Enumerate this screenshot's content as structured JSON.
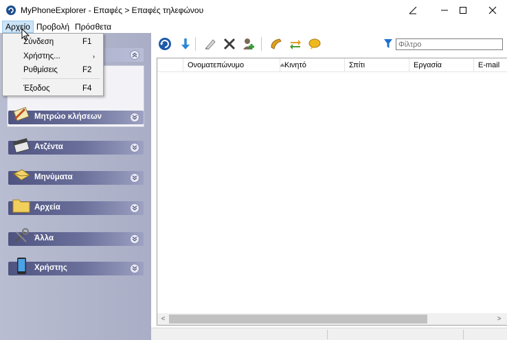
{
  "window": {
    "title": "MyPhoneExplorer -  Επαφές > Επαφές τηλεφώνου",
    "icon": "app-logo-icon"
  },
  "menubar": {
    "items": [
      "Αρχείο",
      "Προβολή",
      "Πρόσθετα"
    ]
  },
  "file_menu": {
    "items": [
      {
        "label": "Σύνδεση",
        "shortcut": "F1"
      },
      {
        "label": "Χρήστης...",
        "shortcut": "",
        "submenu": true
      },
      {
        "label": "Ρυθμίσεις",
        "shortcut": "F2"
      },
      {
        "label": "Έξοδος",
        "shortcut": "F4"
      }
    ],
    "submenu_arrow": "›"
  },
  "nav": {
    "sections": [
      {
        "label": "Μητρώο κλήσεων",
        "icon": "call-log-icon"
      },
      {
        "label": "Ατζέντα",
        "icon": "calendar-icon"
      },
      {
        "label": "Μηνύματα",
        "icon": "envelope-icon"
      },
      {
        "label": "Αρχεία",
        "icon": "folder-icon"
      },
      {
        "label": "Άλλα",
        "icon": "tools-icon"
      },
      {
        "label": "Χρήστης",
        "icon": "phone-device-icon"
      }
    ]
  },
  "toolbar": {
    "buttons": [
      "refresh-icon",
      "download-icon",
      "edit-icon",
      "delete-icon",
      "add-contact-icon",
      "call-icon",
      "sync-icon",
      "message-icon"
    ],
    "filter_placeholder": "Φίλτρο"
  },
  "grid": {
    "columns": [
      "Ονοματεπώνυμο",
      "Κινητό",
      "Σπίτι",
      "Εργασία",
      "E-mail"
    ],
    "sorted_column": "Ονοματεπώνυμο",
    "sort_direction": "ascending"
  },
  "scrollbar": {
    "left_arrow": "<",
    "right_arrow": ">"
  },
  "colors": {
    "nav_header_dark": "#4e5380",
    "nav_header_light": "#9da1c2",
    "menu_highlight": "#cce4f7",
    "accent_blue": "#1e4f8f"
  }
}
